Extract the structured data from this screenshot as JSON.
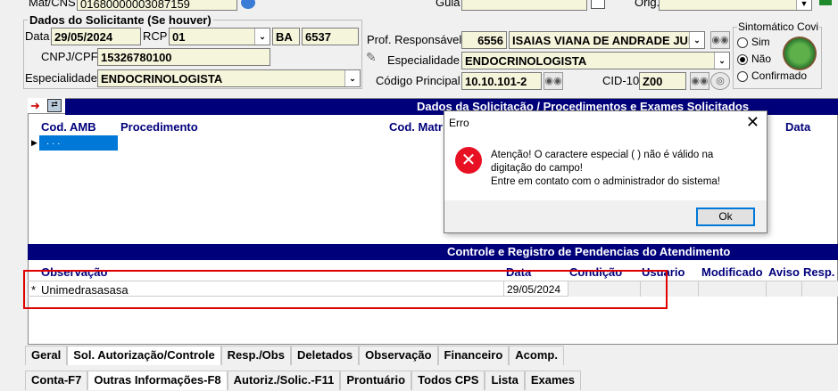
{
  "header": {
    "mat_cns_label": "Mat/CNS",
    "mat_cns_value": "01680000003087159",
    "guia_label": "Guia",
    "orig_label": "Orig."
  },
  "solicitante": {
    "title": "Dados do Solicitante (Se houver)",
    "data_label": "Data",
    "data_value": "29/05/2024",
    "rcp_label": "RCP",
    "rcp_value": "01",
    "uf_value": "BA",
    "crm_value": "6537",
    "cnpj_label": "CNPJ/CPF",
    "cnpj_value": "15326780100",
    "especialidade_label": "Especialidade",
    "especialidade_value": "ENDOCRINOLOGISTA"
  },
  "profissional": {
    "prof_label": "Prof. Responsável",
    "prof_code": "6556",
    "prof_name": "ISAIAS VIANA DE ANDRADE JUN",
    "especialidade_label": "Especialidade",
    "especialidade_value": "ENDOCRINOLOGISTA",
    "codigo_label": "Código Principal",
    "codigo_value": "10.10.101-2",
    "cid_label": "CID-10",
    "cid_value": "Z00"
  },
  "sintomatico": {
    "title": "Sintomático Covi",
    "options": [
      "Sim",
      "Não",
      "Confirmado"
    ],
    "selected": "Não"
  },
  "procedimentos": {
    "bar_title": "Dados da Solicitação / Procedimentos e Exames Solicitados",
    "columns": [
      "Cod. AMB",
      "Procedimento",
      "Cod. Matr",
      "Data"
    ],
    "row_mask": ". . ."
  },
  "pendencias": {
    "bar_title": "Controle e Registro de Pendencias do Atendimento",
    "columns": [
      "Observação",
      "Data",
      "Condição",
      "Usuario",
      "Modificado",
      "Aviso",
      "Resp."
    ],
    "rows": [
      {
        "marker": "*",
        "observacao": "Unimedrasasasa",
        "data": "29/05/2024"
      }
    ]
  },
  "tabs_top": [
    "Geral",
    "Sol. Autorização/Controle",
    "Resp./Obs",
    "Deletados",
    "Observação",
    "Financeiro",
    "Acomp."
  ],
  "tabs_bottom": [
    "Conta-F7",
    "Outras Informações-F8",
    "Autoriz./Solic.-F11",
    "Prontuário",
    "Todos CPS",
    "Lista",
    "Exames"
  ],
  "dialog": {
    "title": "Erro",
    "message_line1": "Atenção! O caractere especial (   ) não é válido na",
    "message_line2": "digitação do campo!",
    "message_line3": "Entre em contato com o administrador do sistema!",
    "ok_label": "Ok"
  },
  "colors": {
    "header_bar": "#00007b",
    "field_bg": "#f5f5dc",
    "highlight_red": "#e00000",
    "error_red": "#e81123",
    "selection_blue": "#0078d7"
  }
}
